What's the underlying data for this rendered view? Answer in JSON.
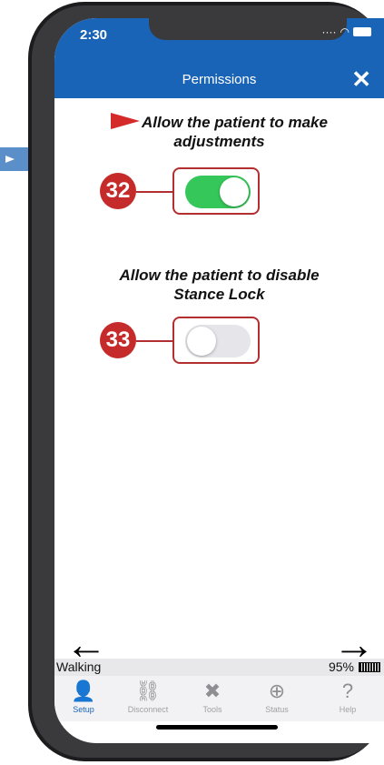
{
  "status": {
    "time": "2:30"
  },
  "header": {
    "title": "Permissions",
    "close_icon": "close-icon"
  },
  "permissions": [
    {
      "label_line1": "Allow the patient to make",
      "label_line2": "adjustments",
      "callout": "32",
      "enabled": true
    },
    {
      "label_line1": "Allow the patient to disable",
      "label_line2": "Stance Lock",
      "callout": "33",
      "enabled": false
    }
  ],
  "navigation": {
    "back_icon": "arrow-left-icon",
    "forward_icon": "arrow-right-icon"
  },
  "device_status": {
    "mode": "Walking",
    "battery": "95%"
  },
  "tabs": [
    {
      "label": "Setup",
      "icon": "user-gear-icon",
      "active": true
    },
    {
      "label": "Disconnect",
      "icon": "broken-link-icon",
      "active": false
    },
    {
      "label": "Tools",
      "icon": "tools-icon",
      "active": false
    },
    {
      "label": "Status",
      "icon": "status-magnifier-icon",
      "active": false
    },
    {
      "label": "Help",
      "icon": "help-icon",
      "active": false
    }
  ],
  "colors": {
    "header": "#1a64b8",
    "toggle_on": "#35c759",
    "callout_red": "#c62b2b"
  }
}
